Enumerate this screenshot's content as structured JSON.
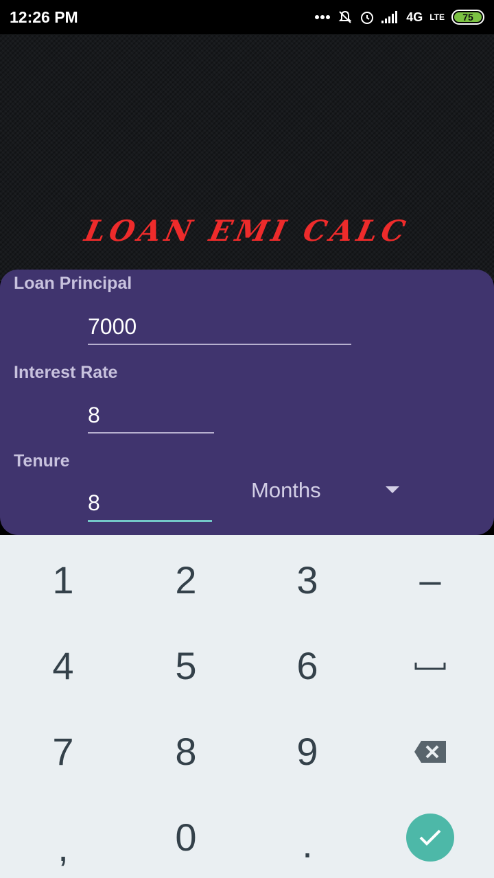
{
  "status_bar": {
    "time": "12:26 PM",
    "network": "4G",
    "volte": "LTE",
    "battery": "75"
  },
  "app": {
    "title": "LOAN EMI CALC"
  },
  "form": {
    "principal_label": "Loan Principal",
    "principal_value": "7000",
    "rate_label": "Interest Rate",
    "rate_value": "8",
    "tenure_label": "Tenure",
    "tenure_value": "8",
    "tenure_unit": "Months"
  },
  "keyboard": {
    "keys": [
      "1",
      "2",
      "3",
      "–",
      "4",
      "5",
      "6",
      "␣",
      "7",
      "8",
      "9",
      "⌫",
      ",",
      "0",
      ".",
      "✓"
    ]
  },
  "colors": {
    "card_bg": "#40346e",
    "title_red": "#ee2b2b",
    "focus_teal": "#74c7c8",
    "enter_green": "#4db8a8"
  }
}
